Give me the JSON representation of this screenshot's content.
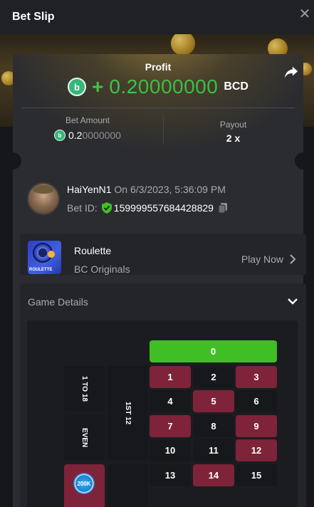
{
  "header": {
    "title": "Bet Slip",
    "close_glyph": "✕"
  },
  "profit": {
    "label": "Profit",
    "sign": "+",
    "value_main": "0.2",
    "value_rest": "0000000",
    "currency": "BCD",
    "currency_icon_glyph": "b"
  },
  "bet_amount": {
    "label": "Bet Amount",
    "value_main": "0.2",
    "value_rest": "0000000"
  },
  "payout": {
    "label": "Payout",
    "value": "2 x"
  },
  "user": {
    "name": "HaiYenN1",
    "date": "On 6/3/2023, 5:36:09 PM",
    "bet_id_label": "Bet ID:",
    "bet_id": "159999557684428829"
  },
  "game": {
    "name": "Roulette",
    "provider": "BC Originals",
    "play_label": "Play Now",
    "thumb_tag": "ROULETTE"
  },
  "details": {
    "title": "Game Details"
  },
  "roulette": {
    "zero": "0",
    "numbers": [
      {
        "n": "1",
        "color": "red"
      },
      {
        "n": "2",
        "color": "black"
      },
      {
        "n": "3",
        "color": "red"
      },
      {
        "n": "4",
        "color": "black"
      },
      {
        "n": "5",
        "color": "red"
      },
      {
        "n": "6",
        "color": "black"
      },
      {
        "n": "7",
        "color": "red"
      },
      {
        "n": "8",
        "color": "black"
      },
      {
        "n": "9",
        "color": "red"
      },
      {
        "n": "10",
        "color": "black"
      },
      {
        "n": "11",
        "color": "black"
      },
      {
        "n": "12",
        "color": "red"
      },
      {
        "n": "13",
        "color": "black"
      },
      {
        "n": "14",
        "color": "red"
      },
      {
        "n": "15",
        "color": "black"
      }
    ],
    "side_bets": [
      "1 TO 18",
      "EVEN"
    ],
    "dozen": "1ST 12",
    "chip_label": "200K"
  },
  "colors": {
    "accent_green": "#3cc548",
    "red": "#7e2339",
    "green": "#3fbf25"
  }
}
